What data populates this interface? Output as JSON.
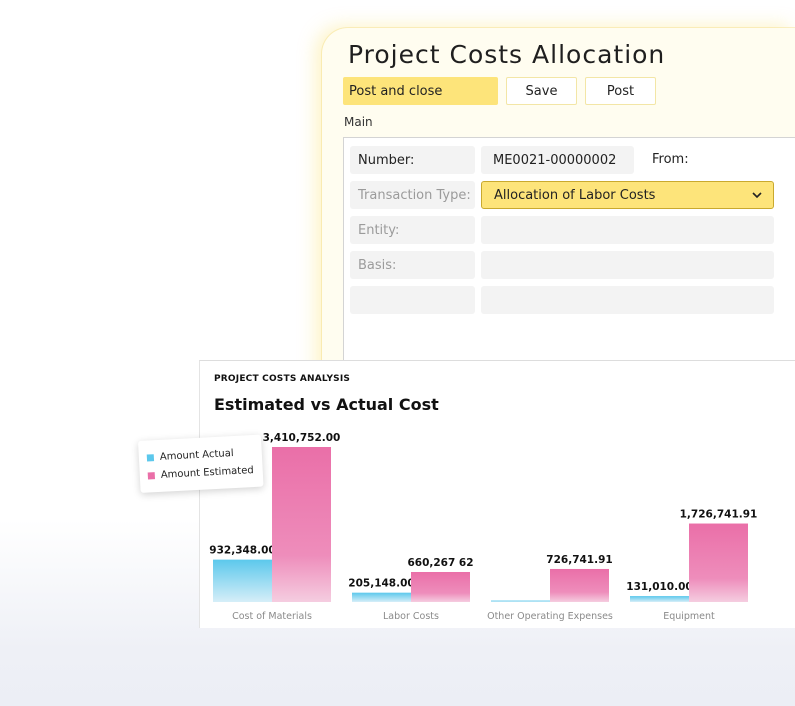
{
  "form": {
    "title": "Project Costs Allocation",
    "toolbar": {
      "post_and_close": "Post and close",
      "save": "Save",
      "post": "Post"
    },
    "section": "Main",
    "fields": {
      "number_label": "Number:",
      "number_value": "ME0021-00000002",
      "from_label": "From:",
      "transaction_type_label": "Transaction Type:",
      "transaction_type_value": "Allocation of Labor Costs",
      "entity_label": "Entity:",
      "basis_label": "Basis:"
    }
  },
  "chart_card": {
    "kicker": "PROJECT COSTS ANALYSIS",
    "title": "Estimated vs Actual Cost"
  },
  "colors": {
    "actual": "#5cc8ec",
    "estimated": "#ea6fa8",
    "accent_yellow": "#fde47a"
  },
  "chart_data": {
    "type": "bar",
    "title": "Estimated vs Actual Cost",
    "categories": [
      "Cost of Materials",
      "Labor Costs",
      "Other Operating Expenses",
      "Equipment"
    ],
    "series": [
      {
        "name": "Amount Actual",
        "values": [
          932348.0,
          205148.0,
          0,
          131010.0
        ],
        "labels": [
          "932,348.00",
          "205,148.00",
          "",
          "131,010.00"
        ]
      },
      {
        "name": "Amount Estimated",
        "values": [
          3410752.0,
          660267.62,
          726741.91,
          1726741.91
        ],
        "labels": [
          "3,410,752.00",
          "660,267 62",
          "726,741.91",
          "1,726,741.91"
        ]
      }
    ],
    "legend": "top-left",
    "grid": false,
    "ylim": [
      0,
      3410752
    ]
  }
}
